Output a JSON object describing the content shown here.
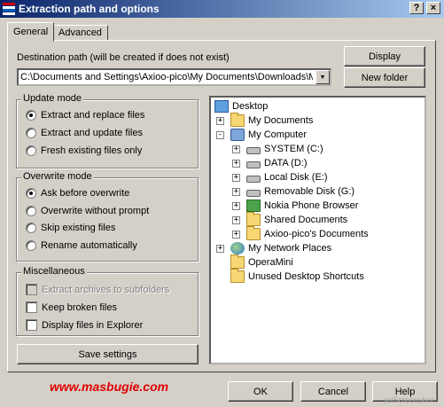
{
  "window": {
    "title": "Extraction path and options",
    "help_button": "?",
    "close_button": "×"
  },
  "tabs": [
    {
      "label": "General"
    },
    {
      "label": "Advanced"
    }
  ],
  "destination": {
    "label": "Destination path (will be created if does not exist)",
    "path": "C:\\Documents and Settings\\Axioo-pico\\My Documents\\Downloads\\M",
    "display_button": "Display",
    "new_folder_button": "New folder"
  },
  "update_mode": {
    "title": "Update mode",
    "options": [
      {
        "label": "Extract and replace files",
        "selected": true
      },
      {
        "label": "Extract and update files",
        "selected": false
      },
      {
        "label": "Fresh existing files only",
        "selected": false
      }
    ]
  },
  "overwrite_mode": {
    "title": "Overwrite mode",
    "options": [
      {
        "label": "Ask before overwrite",
        "selected": true
      },
      {
        "label": "Overwrite without prompt",
        "selected": false
      },
      {
        "label": "Skip existing files",
        "selected": false
      },
      {
        "label": "Rename automatically",
        "selected": false
      }
    ]
  },
  "miscellaneous": {
    "title": "Miscellaneous",
    "options": [
      {
        "label": "Extract archives to subfolders",
        "checked": false,
        "disabled": true
      },
      {
        "label": "Keep broken files",
        "checked": false,
        "disabled": false
      },
      {
        "label": "Display files in Explorer",
        "checked": false,
        "disabled": false
      }
    ]
  },
  "save_settings_button": "Save settings",
  "tree": {
    "items": [
      {
        "label": "Desktop",
        "icon": "desktop-icon"
      },
      {
        "label": "My Documents",
        "icon": "folder-icon",
        "expander": "+"
      },
      {
        "label": "My Computer",
        "icon": "computer-icon",
        "expander": "-"
      },
      {
        "label": "SYSTEM (C:)",
        "icon": "drive-icon",
        "expander": "+"
      },
      {
        "label": "DATA (D:)",
        "icon": "drive-icon",
        "expander": "+"
      },
      {
        "label": "Local Disk (E:)",
        "icon": "drive-icon",
        "expander": "+"
      },
      {
        "label": "Removable Disk (G:)",
        "icon": "drive-icon",
        "expander": "+"
      },
      {
        "label": "Nokia Phone Browser",
        "icon": "phone-icon",
        "expander": "+"
      },
      {
        "label": "Shared Documents",
        "icon": "folder-icon",
        "expander": "+"
      },
      {
        "label": "Axioo-pico's Documents",
        "icon": "folder-icon",
        "expander": "+"
      },
      {
        "label": "My Network Places",
        "icon": "network-icon",
        "expander": "+"
      },
      {
        "label": "OperaMini",
        "icon": "folder-icon"
      },
      {
        "label": "Unused Desktop Shortcuts",
        "icon": "folder-icon"
      }
    ]
  },
  "footer": {
    "watermark": "www.masbugie.com",
    "screenshot_credit": "jetScreenshot",
    "ok_button": "OK",
    "cancel_button": "Cancel",
    "help_button": "Help"
  }
}
